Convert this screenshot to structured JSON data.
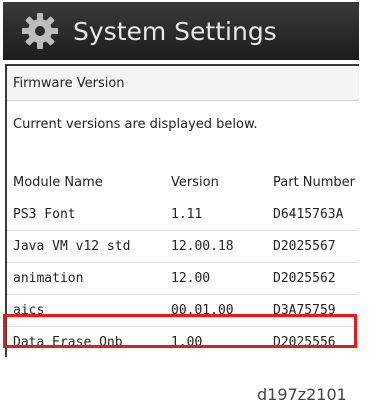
{
  "window": {
    "title": "System Settings",
    "title_icon": "gear-icon"
  },
  "panel": {
    "header": "Firmware Version",
    "description": "Current versions are displayed below."
  },
  "table": {
    "columns": [
      "Module Name",
      "Version",
      "Part Number"
    ],
    "rows": [
      [
        "PS3 Font",
        "1.11",
        "D6415763A"
      ],
      [
        "Java VM v12 std",
        "12.00.18",
        "D2025567"
      ],
      [
        "animation",
        "12.00",
        "D2025562"
      ],
      [
        "aics",
        "00.01.00",
        "D3A75759"
      ],
      [
        "Data Erase Onb",
        "1.00",
        "D2025556"
      ]
    ],
    "highlighted_row": "aics"
  },
  "colors": {
    "title_bar": "#2a2a2a",
    "highlight": "#e31c1c"
  },
  "caption": "d197z2101"
}
